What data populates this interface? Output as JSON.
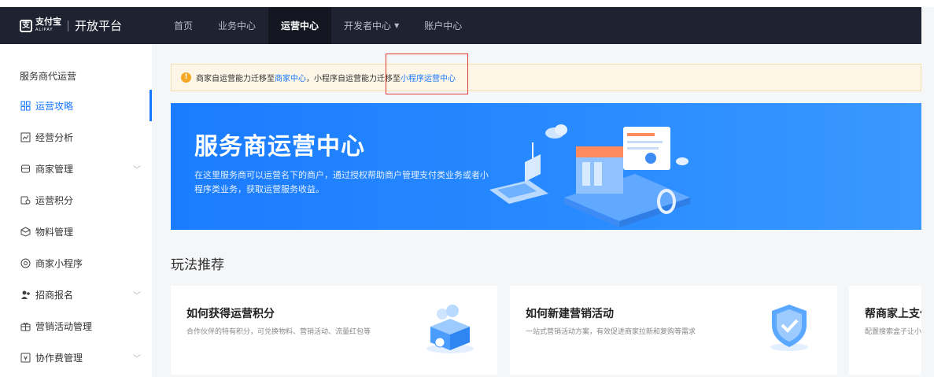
{
  "header": {
    "logo_mark": "支",
    "logo_cn": "支付宝",
    "logo_en": "ALIPAY",
    "platform_title": "开放平台",
    "nav": [
      {
        "label": "首页"
      },
      {
        "label": "业务中心"
      },
      {
        "label": "运营中心"
      },
      {
        "label": "开发者中心"
      },
      {
        "label": "账户中心"
      }
    ]
  },
  "sidebar": {
    "title": "服务商代运营",
    "items": [
      {
        "label": "运营攻略",
        "icon": "grid-icon"
      },
      {
        "label": "经营分析",
        "icon": "chart-icon"
      },
      {
        "label": "商家管理",
        "icon": "store-icon"
      },
      {
        "label": "运营积分",
        "icon": "points-icon"
      },
      {
        "label": "物料管理",
        "icon": "box-icon"
      },
      {
        "label": "商家小程序",
        "icon": "miniapp-icon"
      },
      {
        "label": "招商报名",
        "icon": "users-icon"
      },
      {
        "label": "营销活动管理",
        "icon": "gift-icon"
      },
      {
        "label": "协作费管理",
        "icon": "fee-icon"
      }
    ]
  },
  "notice": {
    "text_1": "商家自运营能力迁移至",
    "link_1": "商家中心",
    "text_2": "，小程序自运营能力迁移至",
    "link_2": "小程序运营中心"
  },
  "banner": {
    "title": "服务商运营中心",
    "desc": "在这里服务商可以运营名下的商户，通过授权帮助商户管理支付类业务或者小程序类业务，获取运营服务收益。"
  },
  "section": {
    "title": "玩法推荐"
  },
  "cards": [
    {
      "title": "如何获得运营积分",
      "desc": "合作伙伴的特有积分，可兑换物料、营销活动、流量红包等"
    },
    {
      "title": "如何新建营销活动",
      "desc": "一站式营销活动方案，有效促进商家拉新和复购等需求"
    },
    {
      "title": "帮商家上支付",
      "desc": "配置搜索盒子让小"
    }
  ],
  "colors": {
    "header_bg": "#1f2331",
    "accent": "#1677ff",
    "banner_bg": "#1a7cff",
    "notice_bg": "#fdf6e7",
    "highlight": "#e53935"
  }
}
